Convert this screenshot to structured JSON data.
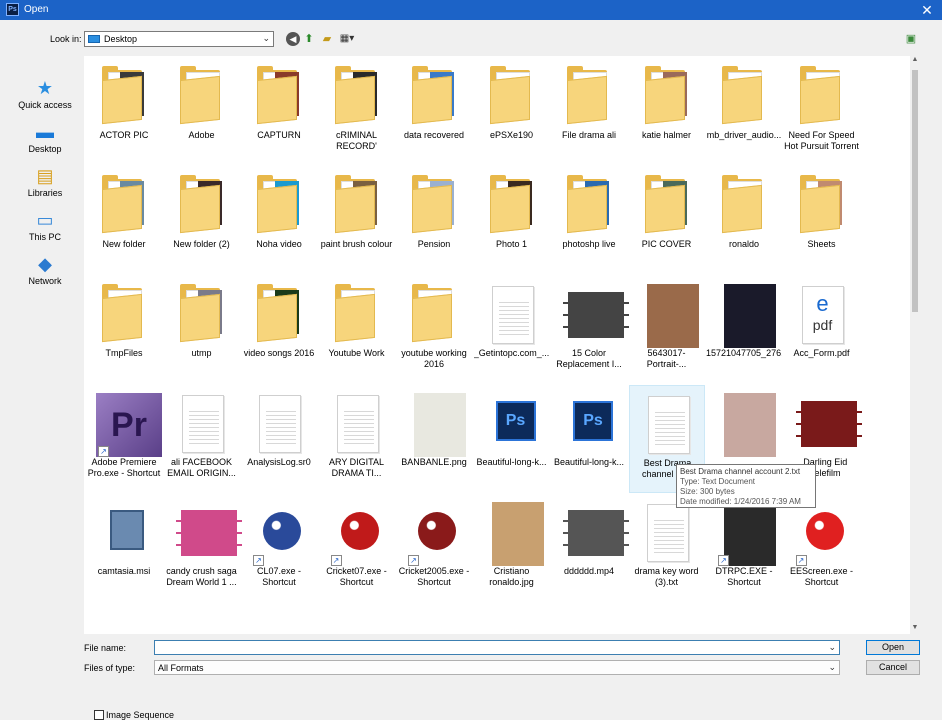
{
  "window": {
    "title": "Open",
    "app_icon": "Ps"
  },
  "toolbar": {
    "lookin_label": "Look in:",
    "lookin_value": "Desktop"
  },
  "places": [
    {
      "label": "Quick access",
      "icon": "star-icon"
    },
    {
      "label": "Desktop",
      "icon": "desktop-icon"
    },
    {
      "label": "Libraries",
      "icon": "libraries-icon"
    },
    {
      "label": "This PC",
      "icon": "computer-icon"
    },
    {
      "label": "Network",
      "icon": "network-icon"
    }
  ],
  "files": [
    {
      "name": "ACTOR PIC",
      "kind": "folder",
      "pic": "#3a3a3a"
    },
    {
      "name": "Adobe",
      "kind": "folder",
      "pic": ""
    },
    {
      "name": "CAPTURN",
      "kind": "folder",
      "pic": "#8a3a2a"
    },
    {
      "name": "cRIMINAL RECORD'",
      "kind": "folder",
      "pic": "#2a2a2a"
    },
    {
      "name": "data recovered",
      "kind": "folder",
      "pic": "#3a7ac8"
    },
    {
      "name": "ePSXe190",
      "kind": "folder",
      "pic": ""
    },
    {
      "name": "File drama ali",
      "kind": "folder",
      "pic": ""
    },
    {
      "name": "katie halmer",
      "kind": "folder",
      "pic": "#9a6a5a"
    },
    {
      "name": "mb_driver_audio...",
      "kind": "folder",
      "pic": ""
    },
    {
      "name": "Need For Speed Hot Pursuit Torrent",
      "kind": "folder",
      "pic": ""
    },
    {
      "name": "New folder",
      "kind": "folder",
      "pic": "#6a8aa0"
    },
    {
      "name": "New folder (2)",
      "kind": "folder",
      "pic": "#3a2a2a"
    },
    {
      "name": "Noha video",
      "kind": "folder",
      "pic": "#1a9ad0"
    },
    {
      "name": "paint brush colour",
      "kind": "folder",
      "pic": "#7a6040"
    },
    {
      "name": "Pension",
      "kind": "folder",
      "pic": "#9ab0d0"
    },
    {
      "name": "Photo 1",
      "kind": "folder",
      "pic": "#3a2a20"
    },
    {
      "name": "photoshp live",
      "kind": "folder",
      "pic": "#2a6ab0"
    },
    {
      "name": "PIC COVER",
      "kind": "folder",
      "pic": "#4a6a5a"
    },
    {
      "name": "ronaldo",
      "kind": "folder",
      "pic": ""
    },
    {
      "name": "Sheets",
      "kind": "folder",
      "pic": "#c08a70"
    },
    {
      "name": "TmpFiles",
      "kind": "folder",
      "pic": ""
    },
    {
      "name": "utmp",
      "kind": "folder",
      "pic": "#7a7a8a"
    },
    {
      "name": "video songs  2016",
      "kind": "folder",
      "pic": "#1a3a1a"
    },
    {
      "name": "Youtube Work",
      "kind": "folder",
      "pic": ""
    },
    {
      "name": "youtube working 2016",
      "kind": "folder",
      "pic": ""
    },
    {
      "name": "_Getintopc.com_...",
      "kind": "doc",
      "pic": ""
    },
    {
      "name": "15 Color Replacement I...",
      "kind": "video",
      "pic": "#444"
    },
    {
      "name": "5643017-Portrait-...",
      "kind": "photo",
      "pic": "#9a6a4a"
    },
    {
      "name": "15721047705_276...",
      "kind": "photo",
      "pic": "#1a1a2a"
    },
    {
      "name": "Acc_Form.pdf",
      "kind": "pdf",
      "pic": ""
    },
    {
      "name": "Adobe Premiere Pro.exe - Shortcut",
      "kind": "premiere",
      "pic": ""
    },
    {
      "name": "ali FACEBOOK EMAIL  ORIGIN...",
      "kind": "doc",
      "pic": ""
    },
    {
      "name": "AnalysisLog.sr0",
      "kind": "doc",
      "pic": ""
    },
    {
      "name": "ARY DIGITAL DRAMA TI...",
      "kind": "doc",
      "pic": ""
    },
    {
      "name": "BANBANLE.png",
      "kind": "photo",
      "pic": "#e8e8e0"
    },
    {
      "name": "Beautiful-long-k...",
      "kind": "ps",
      "pic": ""
    },
    {
      "name": "Beautiful-long-k...",
      "kind": "ps",
      "pic": ""
    },
    {
      "name": "Best Drama channel ac...",
      "kind": "doc",
      "pic": "",
      "selected": true
    },
    {
      "name": "",
      "kind": "photo",
      "pic": "#c8a8a0"
    },
    {
      "name": "...Darling Eid ...Telefilm",
      "kind": "video",
      "pic": "#7a1a1a"
    },
    {
      "name": "camtasia.msi",
      "kind": "installer",
      "pic": ""
    },
    {
      "name": "candy crush saga Dream World 1 ...",
      "kind": "video",
      "pic": "#d04a8a"
    },
    {
      "name": "CL07.exe - Shortcut",
      "kind": "ball",
      "pic": "#2a4a9a"
    },
    {
      "name": "Cricket07.exe - Shortcut",
      "kind": "ball",
      "pic": "#c01a1a"
    },
    {
      "name": "Cricket2005.exe - Shortcut",
      "kind": "ball",
      "pic": "#8a1a1a"
    },
    {
      "name": "Cristiano ronaldo.jpg",
      "kind": "photo",
      "pic": "#c8a070"
    },
    {
      "name": "dddddd.mp4",
      "kind": "video",
      "pic": "#555"
    },
    {
      "name": "drama key word (3).txt",
      "kind": "doc",
      "pic": ""
    },
    {
      "name": "DTRPC.EXE - Shortcut",
      "kind": "photo",
      "pic": "#2a2a2a"
    },
    {
      "name": "EEScreen.exe - Shortcut",
      "kind": "ball",
      "pic": "#e02020"
    }
  ],
  "tooltip": {
    "line1": "Best Drama channel account 2.txt",
    "line2": "Type: Text Document",
    "line3": "Size: 300 bytes",
    "line4": "Date modified: 1/24/2016 7:39 AM"
  },
  "bottom": {
    "filename_label": "File name:",
    "filename_value": "",
    "filetype_label": "Files of type:",
    "filetype_value": "All Formats",
    "open_label": "Open",
    "cancel_label": "Cancel",
    "image_sequence_label": "Image Sequence"
  }
}
